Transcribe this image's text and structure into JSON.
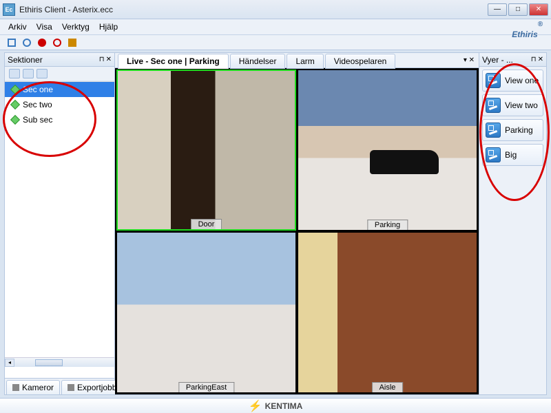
{
  "window": {
    "title": "Ethiris Client - Asterix.ecc"
  },
  "menu": {
    "arkiv": "Arkiv",
    "visa": "Visa",
    "verktyg": "Verktyg",
    "hjalp": "Hjälp"
  },
  "brand": {
    "name": "Ethiris",
    "reg": "®"
  },
  "left": {
    "title": "Sektioner",
    "items": [
      {
        "label": "Sec one",
        "selected": true
      },
      {
        "label": "Sec two",
        "selected": false
      },
      {
        "label": "Sub sec",
        "selected": false
      }
    ],
    "tabs": {
      "kameror": "Kameror",
      "exportjobb": "Exportjobb"
    }
  },
  "tabs": {
    "live": "Live - Sec one | Parking",
    "handelser": "Händelser",
    "larm": "Larm",
    "videospelaren": "Videospelaren"
  },
  "cams": {
    "door": "Door",
    "parking": "Parking",
    "parkingeast": "ParkingEast",
    "aisle": "Aisle"
  },
  "right": {
    "title": "Vyer - ...",
    "items": [
      {
        "label": "View one"
      },
      {
        "label": "View two"
      },
      {
        "label": "Parking"
      },
      {
        "label": "Big"
      }
    ]
  },
  "footer": {
    "brand": "KENTIMA"
  }
}
